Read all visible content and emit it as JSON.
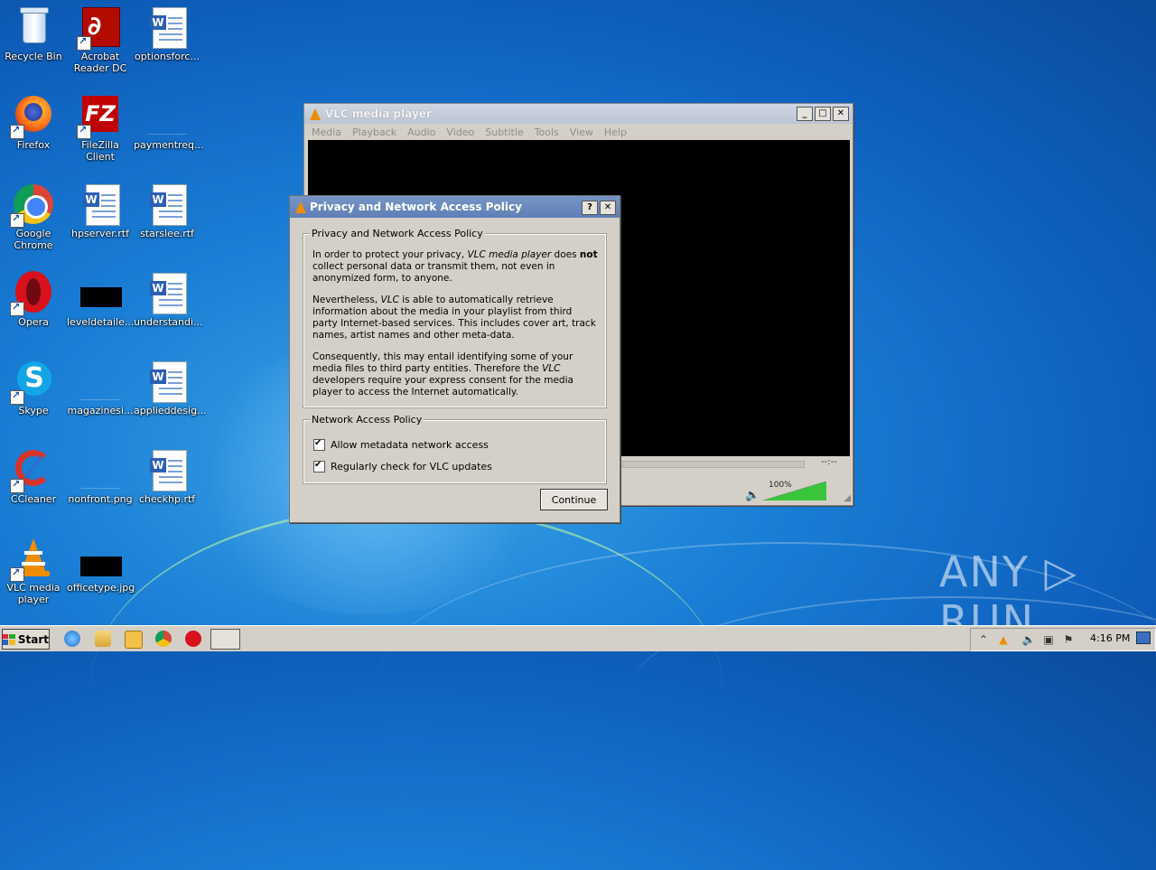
{
  "desktop": {
    "icons": [
      {
        "label": "Recycle Bin"
      },
      {
        "label": "Acrobat Reader DC"
      },
      {
        "label": "optionsforc..."
      },
      {
        "label": "Firefox"
      },
      {
        "label": "FileZilla Client"
      },
      {
        "label": "paymentreq..."
      },
      {
        "label": "Google Chrome"
      },
      {
        "label": "hpserver.rtf"
      },
      {
        "label": "starslee.rtf"
      },
      {
        "label": "Opera"
      },
      {
        "label": "leveldetaile..."
      },
      {
        "label": "understandi..."
      },
      {
        "label": "Skype"
      },
      {
        "label": "magazinesi..."
      },
      {
        "label": "applieddesig..."
      },
      {
        "label": "CCleaner"
      },
      {
        "label": "nonfront.png"
      },
      {
        "label": "checkhp.rtf"
      },
      {
        "label": "VLC media player"
      },
      {
        "label": "officetype.jpg"
      }
    ]
  },
  "vlc": {
    "title": "VLC media player",
    "menu": [
      "Media",
      "Playback",
      "Audio",
      "Video",
      "Subtitle",
      "Tools",
      "View",
      "Help"
    ],
    "time": "--:--",
    "volume": "100%",
    "volume_level": 1.0
  },
  "dialog": {
    "title": "Privacy and Network Access Policy",
    "help_button": "?",
    "close_button": "✕",
    "policy_group": "Privacy and Network Access Policy",
    "p1_a": "In order to protect your privacy, ",
    "p1_app": "VLC media player",
    "p1_b": " does ",
    "p1_not": "not",
    "p1_c": " collect personal data or transmit them, not even in anonymized form, to anyone.",
    "p2_a": "Nevertheless, ",
    "p2_app": "VLC",
    "p2_b": " is able to automatically retrieve information about the media in your playlist from third party Internet-based services. This includes cover art, track names, artist names and other meta-data.",
    "p3_a": "Consequently, this may entail identifying some of your media files to third party entities. Therefore the ",
    "p3_app": "VLC",
    "p3_b": " developers require your express consent for the media player to access the Internet automatically.",
    "network_group": "Network Access Policy",
    "check1": "Allow metadata network access",
    "check2": "Regularly check for VLC updates",
    "continue": "Continue"
  },
  "taskbar": {
    "start": "Start",
    "clock": "4:16 PM"
  },
  "watermark": "ANY ▷ RUN",
  "colors": {
    "desktop_blue": "#1a7fd6",
    "dialog_title": "#5f7fb5",
    "vlc_orange": "#f08c00"
  }
}
